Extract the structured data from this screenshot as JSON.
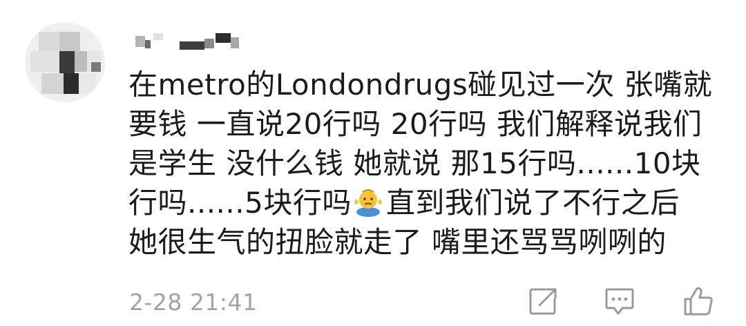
{
  "comment": {
    "username": "",
    "lines": [
      "在metro的Londondrugs碰见过一次 张嘴就",
      "要钱 一直说20行吗 20行吗 我们解释说我们",
      "是学生 没什么钱 她就说 那15行吗......10块",
      "行吗......5块行吗",
      "直到我们说了不行之后",
      "她很生气的扭脸就走了 嘴里还骂骂咧咧的"
    ],
    "timestamp": "2-28 21:41"
  },
  "icons": {
    "emoji": "shrug-emoji-icon",
    "share": "share-icon",
    "reply": "reply-comment-icon",
    "like": "thumbs-up-icon"
  },
  "colors": {
    "text": "#1b1b1b",
    "meta": "#a3a3a3",
    "icon": "#9a9a9a",
    "emoji_face": "#f7c33b",
    "emoji_body": "#4a90d9"
  }
}
